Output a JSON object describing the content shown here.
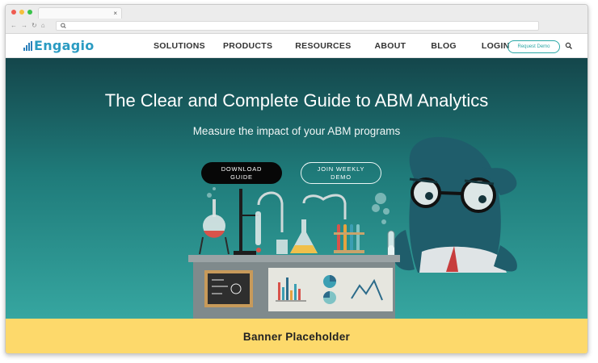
{
  "browser": {
    "tab_close": "×",
    "nav_icons": [
      "back-arrow-icon",
      "forward-arrow-icon",
      "reload-icon",
      "home-icon"
    ],
    "search_icon": "search-icon"
  },
  "header": {
    "logo": "Engagio",
    "nav": [
      "SOLUTIONS",
      "PRODUCTS",
      "RESOURCES",
      "ABOUT",
      "BLOG",
      "LOGIN"
    ],
    "demo_button": "Request Demo",
    "search_icon": "search-icon"
  },
  "hero": {
    "title": "The Clear and Complete Guide to ABM Analytics",
    "subtitle": "Measure the impact of your ABM programs",
    "primary_button": "DOWNLOAD GUIDE",
    "secondary_button": "JOIN WEEKLY DEMO"
  },
  "banner": {
    "text": "Banner Placeholder"
  },
  "colors": {
    "brand": "#2a9bc2",
    "accent": "#2aa7a6",
    "hero_top": "#14464b",
    "hero_bottom": "#36a6a0",
    "banner": "#fdd96b",
    "button_dark": "#070707"
  }
}
